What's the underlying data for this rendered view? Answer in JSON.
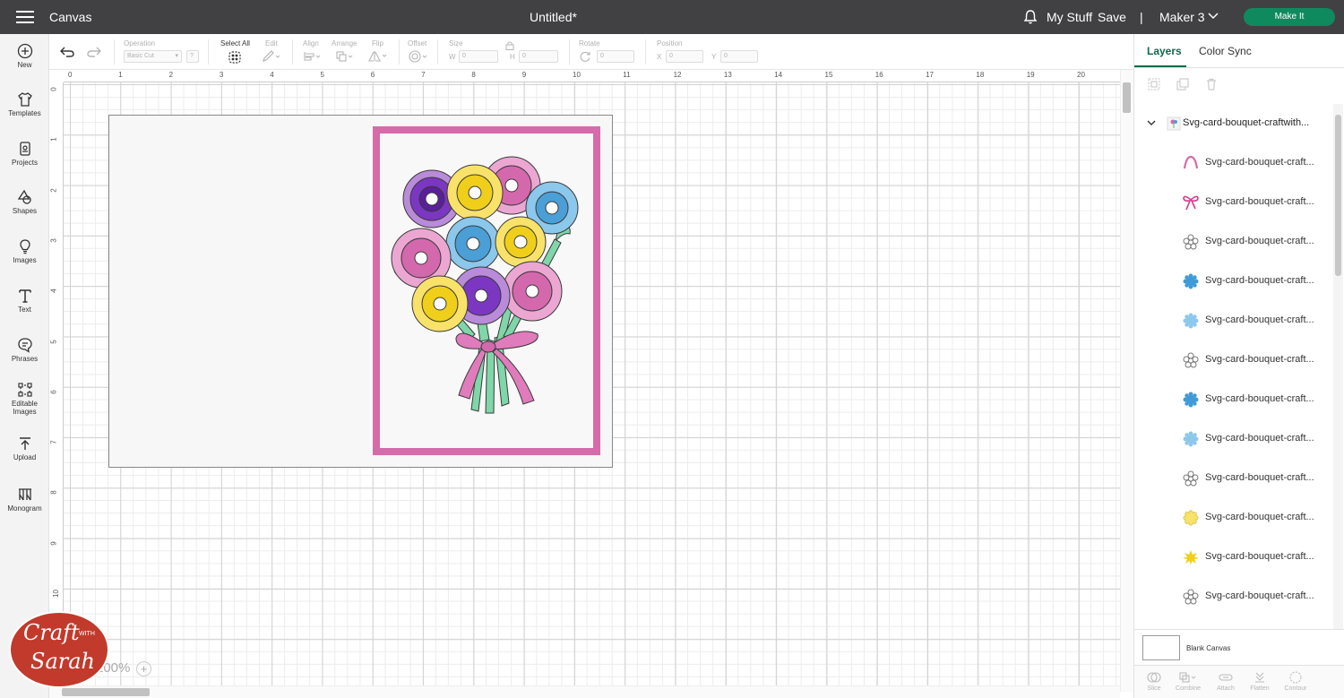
{
  "topbar": {
    "app_title": "Canvas",
    "doc_title": "Untitled*",
    "my_stuff": "My Stuff",
    "save": "Save",
    "separator": "|",
    "machine": "Maker 3",
    "make_it": "Make It"
  },
  "sidebar": {
    "items": [
      {
        "label": "New",
        "icon": "plus-circle-icon"
      },
      {
        "label": "Templates",
        "icon": "shirt-icon"
      },
      {
        "label": "Projects",
        "icon": "projects-icon"
      },
      {
        "label": "Shapes",
        "icon": "shapes-icon"
      },
      {
        "label": "Images",
        "icon": "lightbulb-icon"
      },
      {
        "label": "Text",
        "icon": "text-icon"
      },
      {
        "label": "Phrases",
        "icon": "speech-bubble-icon"
      },
      {
        "label": "Editable",
        "label2": "Images",
        "icon": "editable-images-icon"
      },
      {
        "label": "Upload",
        "icon": "upload-icon"
      },
      {
        "label": "Monogram",
        "icon": "monogram-icon"
      }
    ]
  },
  "toolbar": {
    "operation_label": "Operation",
    "operation_value": "Basic Cut",
    "help": "?",
    "select_all": "Select All",
    "edit": "Edit",
    "align": "Align",
    "arrange": "Arrange",
    "flip": "Flip",
    "offset": "Offset",
    "size": "Size",
    "w": "W",
    "w_value": "0",
    "h": "H",
    "h_value": "0",
    "rotate": "Rotate",
    "rotate_value": "0",
    "position": "Position",
    "x": "X",
    "x_value": "0",
    "y": "Y",
    "y_value": "0"
  },
  "ruler": {
    "horizontal": [
      "0",
      "1",
      "2",
      "3",
      "4",
      "5",
      "6",
      "7",
      "8",
      "9",
      "10",
      "11",
      "12",
      "13",
      "14",
      "15",
      "16",
      "17",
      "18",
      "19",
      "20"
    ],
    "vertical": [
      "0",
      "1",
      "2",
      "3",
      "4",
      "5",
      "6",
      "7",
      "8",
      "9",
      "10"
    ]
  },
  "canvas": {
    "zoom": "100%",
    "zoom_plus": "+"
  },
  "panel": {
    "tabs": [
      "Layers",
      "Color Sync"
    ],
    "group_name": "Svg-card-bouquet-craftwith...",
    "layers": [
      {
        "name": "Svg-card-bouquet-craft...",
        "icon": "arch-icon",
        "color": "#d56ba9"
      },
      {
        "name": "Svg-card-bouquet-craft...",
        "icon": "bow-icon",
        "color": "#d6398c"
      },
      {
        "name": "Svg-card-bouquet-craft...",
        "icon": "flower-outline-icon",
        "color": "#ffffff"
      },
      {
        "name": "Svg-card-bouquet-craft...",
        "icon": "flower-icon",
        "color": "#3f9ad8"
      },
      {
        "name": "Svg-card-bouquet-craft...",
        "icon": "flower-icon",
        "color": "#8cc7ec"
      },
      {
        "name": "Svg-card-bouquet-craft...",
        "icon": "flower-outline-icon",
        "color": "#ffffff"
      },
      {
        "name": "Svg-card-bouquet-craft...",
        "icon": "flower-icon",
        "color": "#3f9ad8"
      },
      {
        "name": "Svg-card-bouquet-craft...",
        "icon": "flower-icon",
        "color": "#8cc7ec"
      },
      {
        "name": "Svg-card-bouquet-craft...",
        "icon": "flower-outline-icon",
        "color": "#ffffff"
      },
      {
        "name": "Svg-card-bouquet-craft...",
        "icon": "scalloped-circle-icon",
        "color": "#f8e26a"
      },
      {
        "name": "Svg-card-bouquet-craft...",
        "icon": "sunflower-icon",
        "color": "#f0cf1b"
      },
      {
        "name": "Svg-card-bouquet-craft...",
        "icon": "flower-outline-icon",
        "color": "#ffffff"
      }
    ],
    "blank_canvas": "Blank Canvas",
    "bottom_tools": [
      "Slice",
      "Combine",
      "Attach",
      "Flatten",
      "Contour"
    ]
  },
  "logo": {
    "line1": "Craft",
    "with": "WITH",
    "line2": "Sarah"
  },
  "colors": {
    "topbar": "#414042",
    "accent_green": "#0f8a5f",
    "card_pink": "#d56ba9"
  }
}
